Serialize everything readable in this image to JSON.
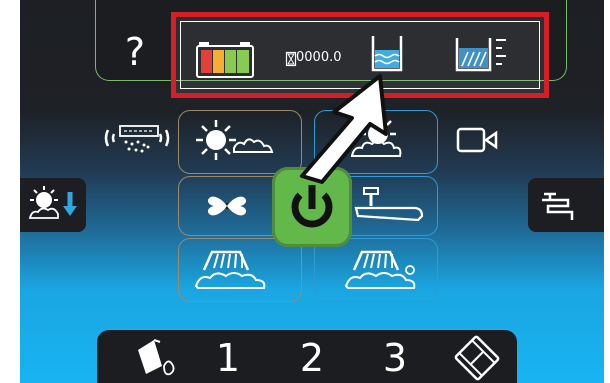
{
  "top_panel": {
    "help_symbol": "?",
    "hour_meter": "0000.0",
    "battery_colors": [
      "#e0302a",
      "#f5a623",
      "#7dc742",
      "#7dc742"
    ],
    "icons": [
      "help-icon",
      "battery-icon",
      "hourglass-icon",
      "water-tank-icon",
      "dirty-water-tank-icon"
    ]
  },
  "modes": {
    "left": [
      "spray-icon",
      "brush-foam-icon",
      "fan-icon",
      "scrub-deck-icon"
    ],
    "right": [
      "camera-icon",
      "brush-foam-icon",
      "squeegee-icon",
      "scrub-deck-icon"
    ],
    "center": "power-icon"
  },
  "bottom_bar": {
    "presets": [
      "1",
      "2",
      "3"
    ],
    "icons": [
      "detergent-icon",
      "film-icon"
    ]
  },
  "colors": {
    "accent_green": "#63b84a",
    "highlight_red": "#d41f26",
    "blue_border": "#2d9cd6",
    "panel_dark": "#1b1d21"
  }
}
